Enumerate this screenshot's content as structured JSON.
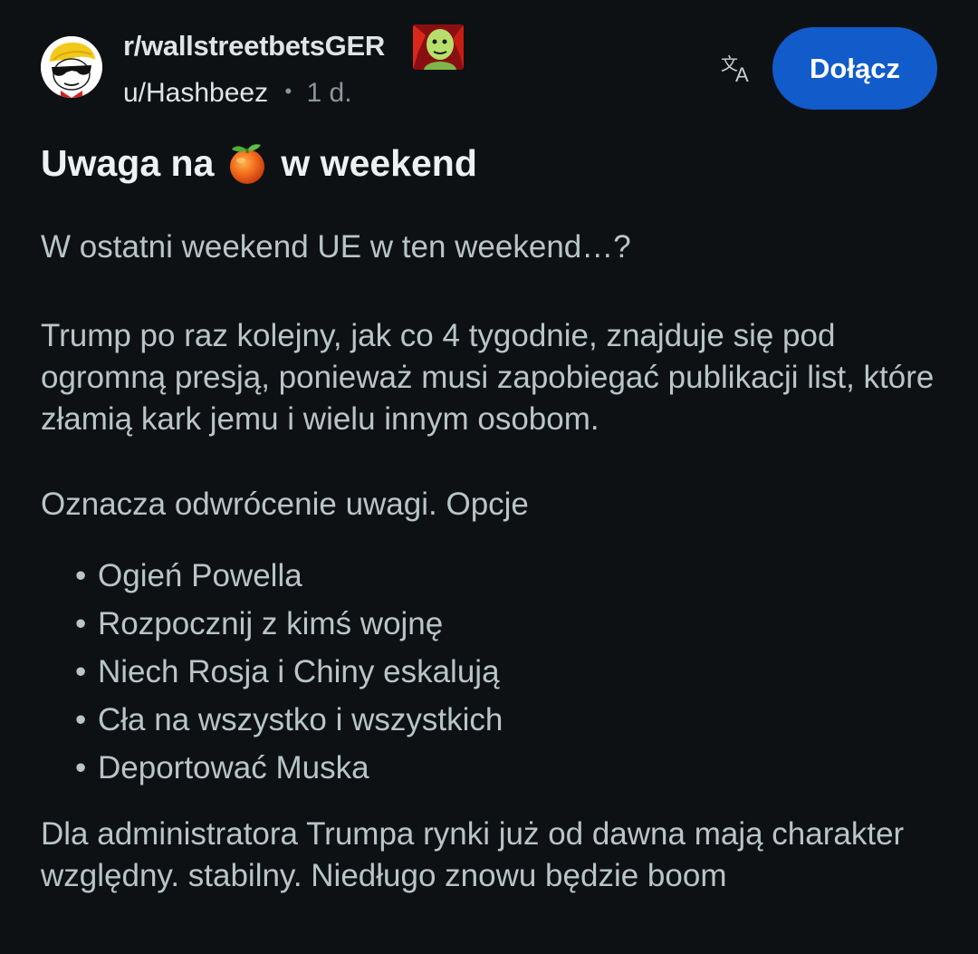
{
  "post": {
    "subreddit": "r/wallstreetbetsGER",
    "author": "u/Hashbeez",
    "separator": "•",
    "age": "1 d.",
    "title_before": "Uwaga na",
    "title_emoji": "tangerine-emoji",
    "title_after": "w weekend",
    "paragraphs": [
      "W ostatni weekend UE w ten weekend…?",
      "Trump po raz kolejny, jak co 4 tygodnie, znajduje się pod ogromną presją, ponieważ musi zapobiegać publikacji list, które złamią kark jemu i wielu innym osobom.",
      "Oznacza odwrócenie uwagi. Opcje",
      "Dla administratora Trumpa rynki już od dawna mają charakter względny. stabilny. Niedługo znowu będzie boom"
    ],
    "bullets": [
      "Ogień Powella",
      "Rozpocznij z kimś wojnę",
      "Niech Rosja i Chiny eskalują",
      "Cła na wszystko i wszystkich",
      "Deportować Muska"
    ]
  },
  "header": {
    "avatar_icon": "wsb-mascot-icon",
    "flair_icon": "user-flair-image",
    "translate_icon": "translate-icon",
    "join_label": "Dołącz"
  },
  "colors": {
    "background": "#0e1113",
    "join_button": "#115bca",
    "body_text": "#b8c5c9",
    "title_text": "#eef1f2"
  }
}
